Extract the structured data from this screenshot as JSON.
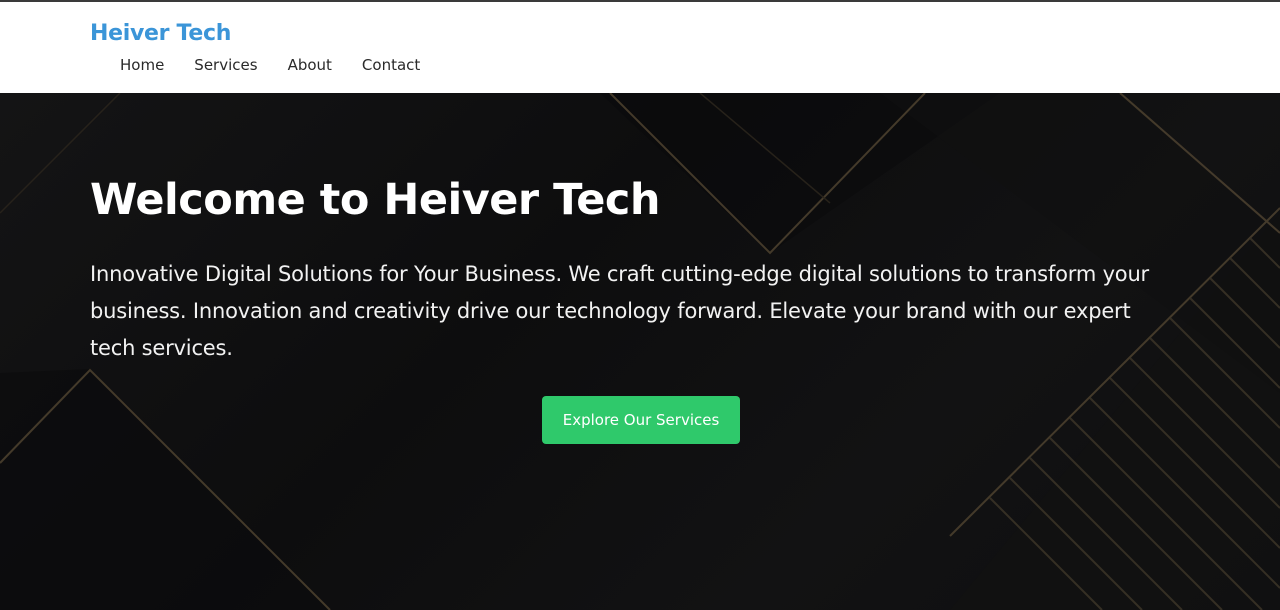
{
  "header": {
    "brand": "Heiver Tech",
    "nav": [
      "Home",
      "Services",
      "About",
      "Contact"
    ]
  },
  "hero": {
    "title": "Welcome to Heiver Tech",
    "text": "Innovative Digital Solutions for Your Business. We craft cutting-edge digital solutions to transform your business. Innovation and creativity drive our technology forward. Elevate your brand with our expert tech services.",
    "button_label": "Explore Our Services"
  },
  "colors": {
    "brand": "#3b95d8",
    "hero_bg": "#0f0f10",
    "cta": "#2fc96b",
    "line_accent": "#4a3f2e"
  }
}
